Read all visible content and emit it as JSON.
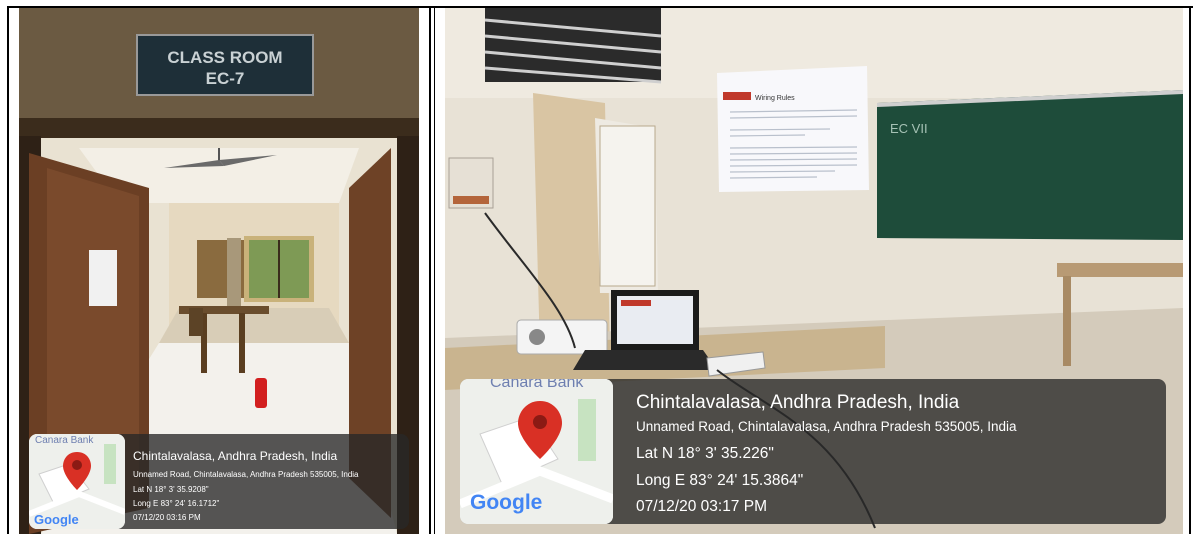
{
  "left_photo": {
    "sign_line1": "CLASS ROOM",
    "sign_line2": "EC-7",
    "overlay": {
      "map_poi": "Canara Bank",
      "map_brand": "Google",
      "place": "Chintalavalasa, Andhra Pradesh, India",
      "address": "Unnamed Road, Chintalavalasa, Andhra Pradesh 535005, India",
      "lat": "Lat N 18° 3' 35.9208\"",
      "long": "Long E 83° 24' 16.1712\"",
      "datetime": "07/12/20 03:16 PM"
    }
  },
  "right_photo": {
    "board_text": "EC VII",
    "slide_title": "Wiring Rules",
    "overlay": {
      "map_poi": "Canara Bank",
      "map_brand": "Google",
      "place": "Chintalavalasa, Andhra Pradesh, India",
      "address": "Unnamed Road, Chintalavalasa, Andhra Pradesh 535005, India",
      "lat": "Lat N 18° 3' 35.226\"",
      "long": "Long E 83° 24' 15.3864\"",
      "datetime": "07/12/20 03:17 PM"
    }
  },
  "colors": {
    "google_blue": "#4285F4",
    "google_red": "#EA4335",
    "google_yellow": "#FBBC05",
    "google_green": "#34A853",
    "pin_red": "#d93025",
    "overlay_bg": "#282828"
  }
}
